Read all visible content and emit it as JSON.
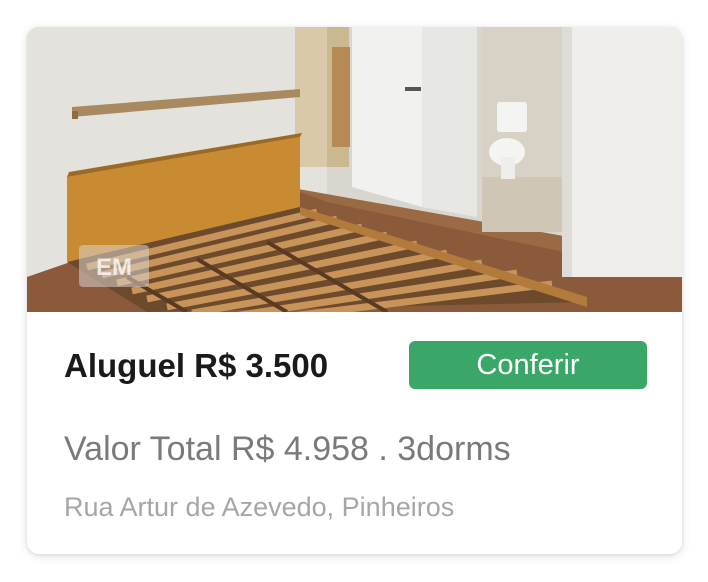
{
  "listing": {
    "image_alt_icon": "property-photo",
    "watermark_text": "EM",
    "rent_label": "Aluguel R$ 3.500",
    "cta_label": "Conferir",
    "total_line": "Valor Total R$ 4.958 . 3dorms",
    "address": "Rua Artur de Azevedo, Pinheiros"
  },
  "colors": {
    "cta_background": "#3aa769",
    "cta_text": "#ffffff",
    "title_text": "#1a1a1a",
    "secondary_text": "#7a7a7a",
    "tertiary_text": "#a6a6a6"
  }
}
